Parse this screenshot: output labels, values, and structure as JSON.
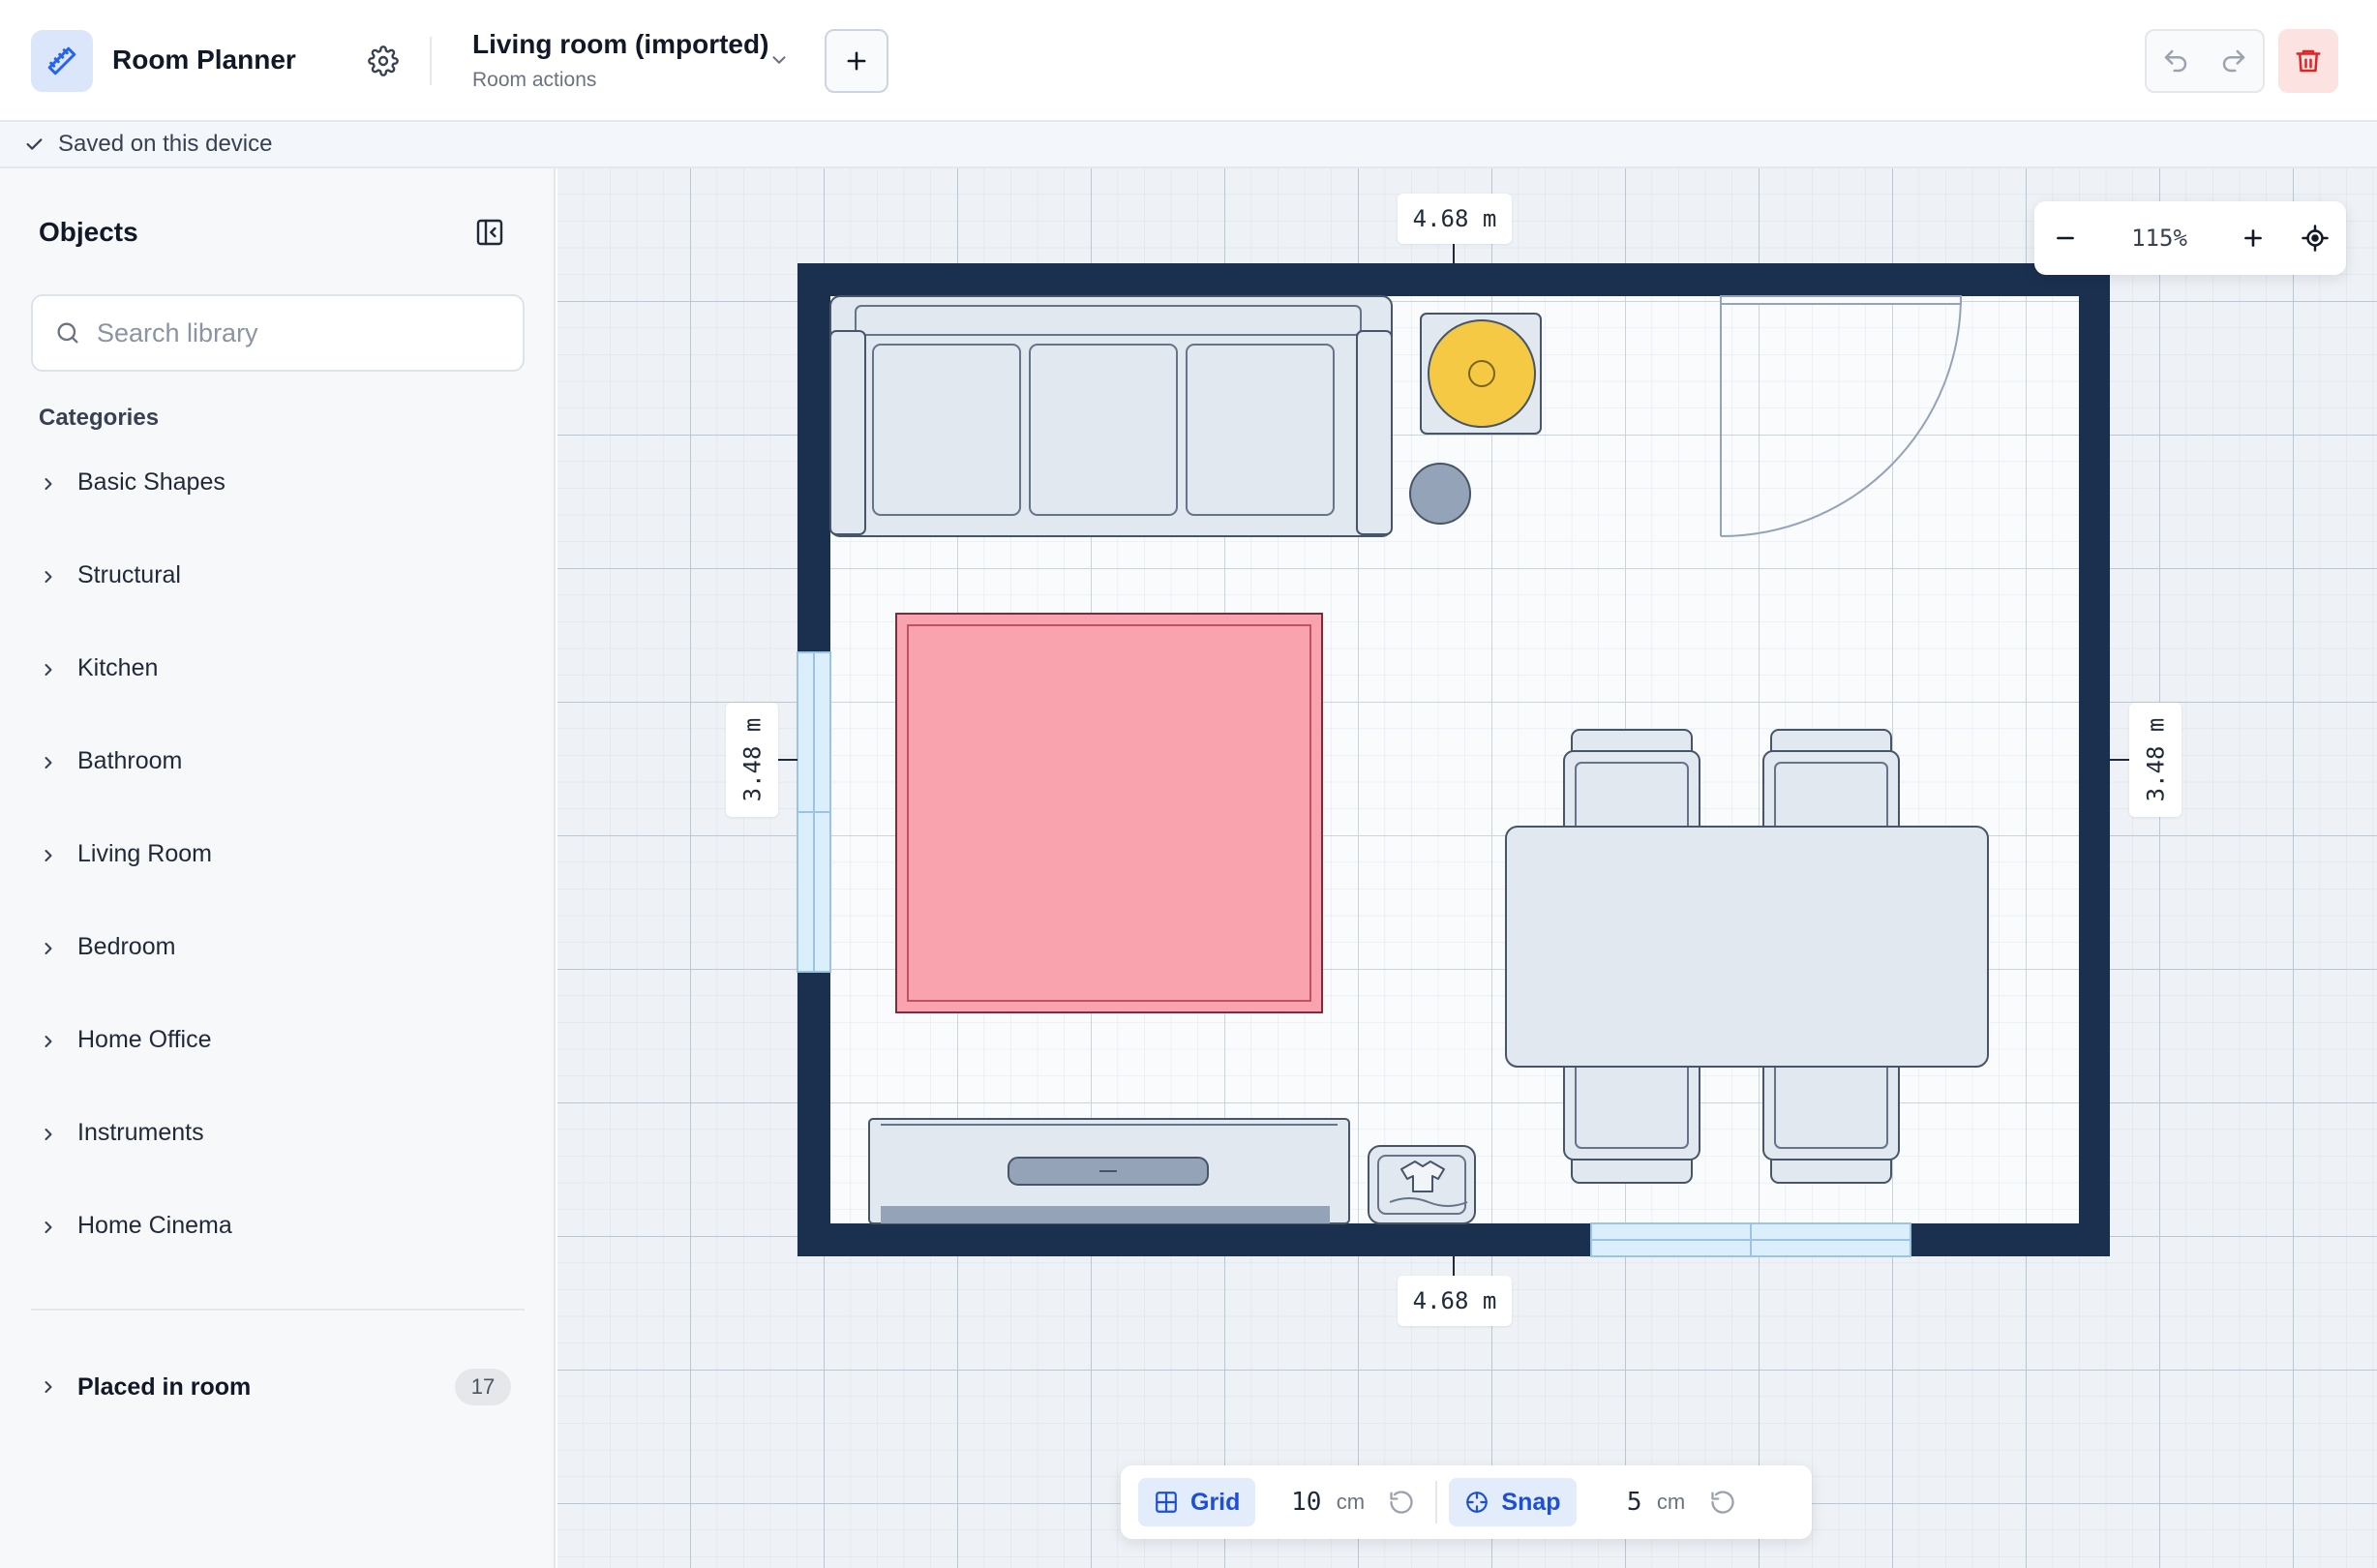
{
  "header": {
    "app_title": "Room Planner",
    "room_name": "Living room (imported)",
    "room_actions": "Room actions"
  },
  "status": {
    "text": "Saved on this device"
  },
  "sidebar": {
    "title": "Objects",
    "search_placeholder": "Search library",
    "categories_heading": "Categories",
    "categories": [
      {
        "label": "Basic Shapes"
      },
      {
        "label": "Structural"
      },
      {
        "label": "Kitchen"
      },
      {
        "label": "Bathroom"
      },
      {
        "label": "Living Room"
      },
      {
        "label": "Bedroom"
      },
      {
        "label": "Home Office"
      },
      {
        "label": "Instruments"
      },
      {
        "label": "Home Cinema"
      }
    ],
    "placed": {
      "label": "Placed in room",
      "count": "17"
    }
  },
  "canvas": {
    "dimensions": {
      "top": "4.68 m",
      "bottom": "4.68 m",
      "left": "3.48 m",
      "right": "3.48 m"
    },
    "zoom": "115%"
  },
  "toolbar": {
    "grid_label": "Grid",
    "grid_value": "10",
    "grid_unit": "cm",
    "snap_label": "Snap",
    "snap_value": "5",
    "snap_unit": "cm"
  },
  "colors": {
    "wall": "#1b2f4f",
    "rug": "#f9a3ae",
    "lamp": "#f6c945",
    "accent": "#2563eb",
    "danger": "#dc2626"
  }
}
